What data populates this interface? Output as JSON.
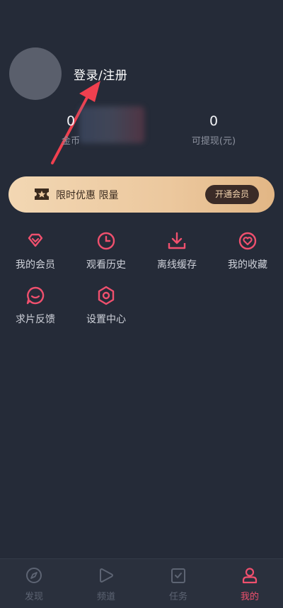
{
  "profile": {
    "login_label": "登录/注册",
    "coins_value": "0",
    "coins_label": "金币",
    "cash_value": "0",
    "cash_label": "可提现(元)"
  },
  "vip_banner": {
    "text": "限时优惠 限量",
    "button_label": "开通会员"
  },
  "menu": [
    {
      "label": "我的会员",
      "icon": "diamond-icon"
    },
    {
      "label": "观看历史",
      "icon": "clock-icon"
    },
    {
      "label": "离线缓存",
      "icon": "download-icon"
    },
    {
      "label": "我的收藏",
      "icon": "heart-icon"
    },
    {
      "label": "求片反馈",
      "icon": "chat-icon"
    },
    {
      "label": "设置中心",
      "icon": "settings-icon"
    }
  ],
  "tabbar": [
    {
      "label": "发现",
      "icon": "compass-icon",
      "active": false
    },
    {
      "label": "频道",
      "icon": "play-icon",
      "active": false
    },
    {
      "label": "任务",
      "icon": "task-icon",
      "active": false
    },
    {
      "label": "我的",
      "icon": "user-icon",
      "active": true
    }
  ],
  "colors": {
    "background": "#252b38",
    "accent": "#f0506e",
    "vip_gold": "#ecc89e"
  }
}
